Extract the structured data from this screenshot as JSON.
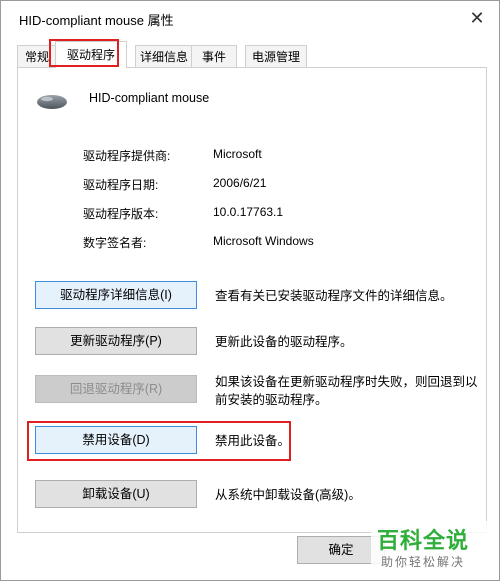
{
  "window": {
    "title": "HID-compliant mouse 属性",
    "close_glyph": "✕"
  },
  "tabs": [
    {
      "label": "常规"
    },
    {
      "label": "驱动程序",
      "active": true
    },
    {
      "label": "详细信息"
    },
    {
      "label": "事件"
    },
    {
      "label": "电源管理"
    }
  ],
  "device": {
    "name": "HID-compliant mouse",
    "icon": "mouse-icon"
  },
  "properties": [
    {
      "label": "驱动程序提供商:",
      "value": "Microsoft"
    },
    {
      "label": "驱动程序日期:",
      "value": "2006/6/21"
    },
    {
      "label": "驱动程序版本:",
      "value": "10.0.17763.1"
    },
    {
      "label": "数字签名者:",
      "value": "Microsoft Windows"
    }
  ],
  "actions": [
    {
      "label": "驱动程序详细信息(I)",
      "description": "查看有关已安装驱动程序文件的详细信息。"
    },
    {
      "label": "更新驱动程序(P)",
      "description": "更新此设备的驱动程序。"
    },
    {
      "label": "回退驱动程序(R)",
      "description": "如果该设备在更新驱动程序时失败，则回退到以前安装的驱动程序。",
      "disabled": true
    },
    {
      "label": "禁用设备(D)",
      "description": "禁用此设备。"
    },
    {
      "label": "卸载设备(U)",
      "description": "从系统中卸载设备(高级)。"
    }
  ],
  "footer": {
    "ok_label": "确定"
  },
  "watermark": {
    "main": "百科全说",
    "sub": "助你轻松解决"
  },
  "colors": {
    "highlight": "#e02020",
    "accent": "#3c8be0",
    "watermark": "#2fae3a"
  }
}
